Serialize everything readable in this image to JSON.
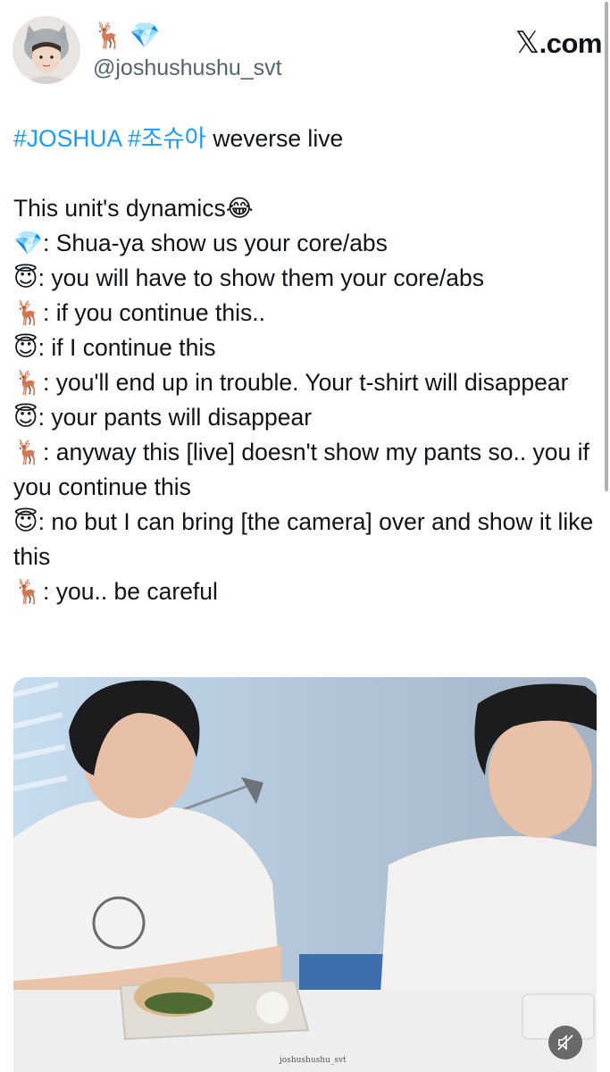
{
  "header": {
    "display_name_emojis": "🦌💎",
    "handle": "@joshushushu_svt",
    "site_label": "X.com",
    "site_x_glyph": "𝕏",
    "site_suffix": ".com"
  },
  "tweet": {
    "hashtags": [
      "#JOSHUA",
      "#조슈아"
    ],
    "line1_rest": " weverse live",
    "intro": "This unit's dynamics",
    "intro_emoji": "😂",
    "dialogue": [
      {
        "emoji": "💎",
        "text": ": Shua-ya show us your core/abs"
      },
      {
        "emoji": "😇",
        "text": ": you will have to show them your core/abs"
      },
      {
        "emoji": "🦌",
        "text": ": if you continue this.."
      },
      {
        "emoji": "😇",
        "text": ": if I continue this"
      },
      {
        "emoji": "🦌",
        "text": ": you'll end up in trouble. Your t-shirt will disappear"
      },
      {
        "emoji": "😇",
        "text": ": your pants will disappear"
      },
      {
        "emoji": "🦌",
        "text": ": anyway this [live] doesn't show my pants so.. you if you continue this"
      },
      {
        "emoji": "😇",
        "text": ": no but I can bring [the camera] over and show it like this"
      },
      {
        "emoji": "🦌",
        "text": ": you.. be careful"
      }
    ]
  },
  "media": {
    "watermark": "joshushushu_svt",
    "mute_icon": "speaker-muted-icon"
  },
  "colors": {
    "hashtag": "#1d9bf0",
    "text": "#0f1419",
    "secondary": "#536471"
  }
}
